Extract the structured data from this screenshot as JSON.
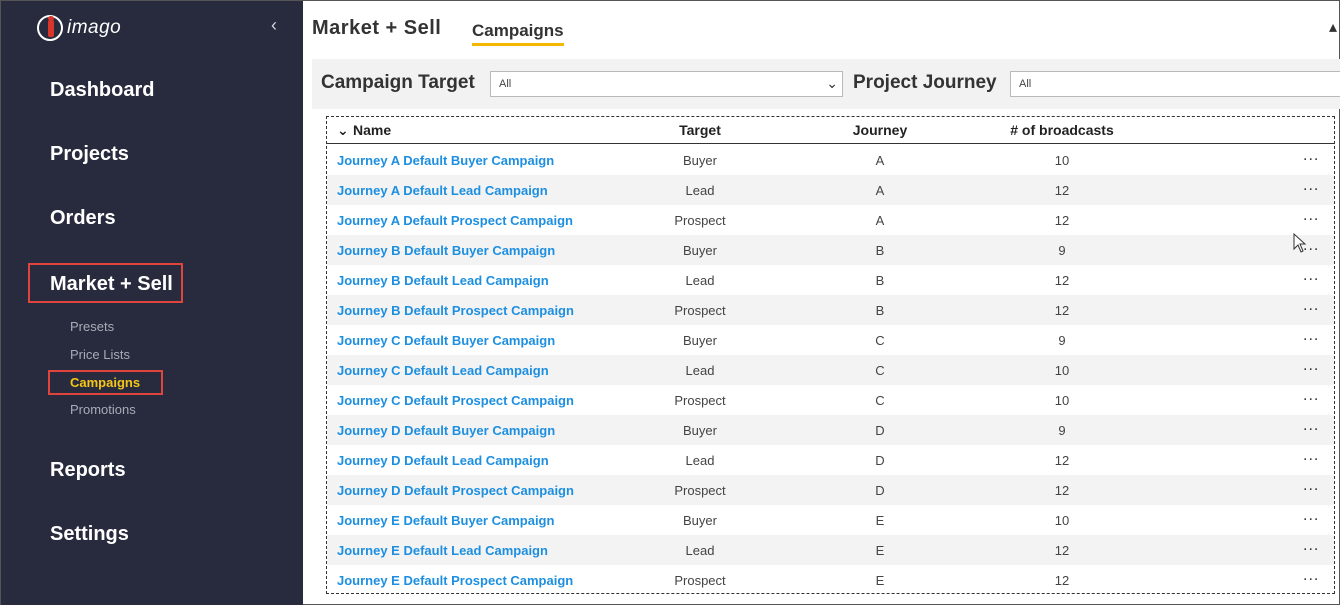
{
  "sidebar": {
    "logo_text": "imago",
    "nav": {
      "dashboard": "Dashboard",
      "projects": "Projects",
      "orders": "Orders",
      "market_sell": "Market + Sell",
      "reports": "Reports",
      "settings": "Settings"
    },
    "sub": {
      "presets": "Presets",
      "price_lists": "Price Lists",
      "campaigns": "Campaigns",
      "promotions": "Promotions"
    }
  },
  "header": {
    "title": "Market + Sell",
    "tab": "Campaigns"
  },
  "filters": {
    "campaign_target_label": "Campaign Target",
    "campaign_target_value": "All",
    "project_journey_label": "Project Journey",
    "project_journey_value": "All"
  },
  "table": {
    "headers": {
      "name": "Name",
      "target": "Target",
      "journey": "Journey",
      "broadcasts": "# of broadcasts"
    },
    "more": "...",
    "rows": [
      {
        "name": "Journey A Default Buyer Campaign",
        "target": "Buyer",
        "journey": "A",
        "broadcasts": "10"
      },
      {
        "name": "Journey A Default Lead Campaign",
        "target": "Lead",
        "journey": "A",
        "broadcasts": "12"
      },
      {
        "name": "Journey A Default Prospect Campaign",
        "target": "Prospect",
        "journey": "A",
        "broadcasts": "12"
      },
      {
        "name": "Journey B Default Buyer Campaign",
        "target": "Buyer",
        "journey": "B",
        "broadcasts": "9"
      },
      {
        "name": "Journey B Default Lead Campaign",
        "target": "Lead",
        "journey": "B",
        "broadcasts": "12"
      },
      {
        "name": "Journey B Default Prospect Campaign",
        "target": "Prospect",
        "journey": "B",
        "broadcasts": "12"
      },
      {
        "name": "Journey C Default Buyer Campaign",
        "target": "Buyer",
        "journey": "C",
        "broadcasts": "9"
      },
      {
        "name": "Journey C Default Lead Campaign",
        "target": "Lead",
        "journey": "C",
        "broadcasts": "10"
      },
      {
        "name": "Journey C Default Prospect Campaign",
        "target": "Prospect",
        "journey": "C",
        "broadcasts": "10"
      },
      {
        "name": "Journey D Default Buyer Campaign",
        "target": "Buyer",
        "journey": "D",
        "broadcasts": "9"
      },
      {
        "name": "Journey D Default Lead Campaign",
        "target": "Lead",
        "journey": "D",
        "broadcasts": "12"
      },
      {
        "name": "Journey D Default Prospect Campaign",
        "target": "Prospect",
        "journey": "D",
        "broadcasts": "12"
      },
      {
        "name": "Journey E Default Buyer Campaign",
        "target": "Buyer",
        "journey": "E",
        "broadcasts": "10"
      },
      {
        "name": "Journey E Default Lead Campaign",
        "target": "Lead",
        "journey": "E",
        "broadcasts": "12"
      },
      {
        "name": "Journey E Default Prospect Campaign",
        "target": "Prospect",
        "journey": "E",
        "broadcasts": "12"
      }
    ]
  }
}
